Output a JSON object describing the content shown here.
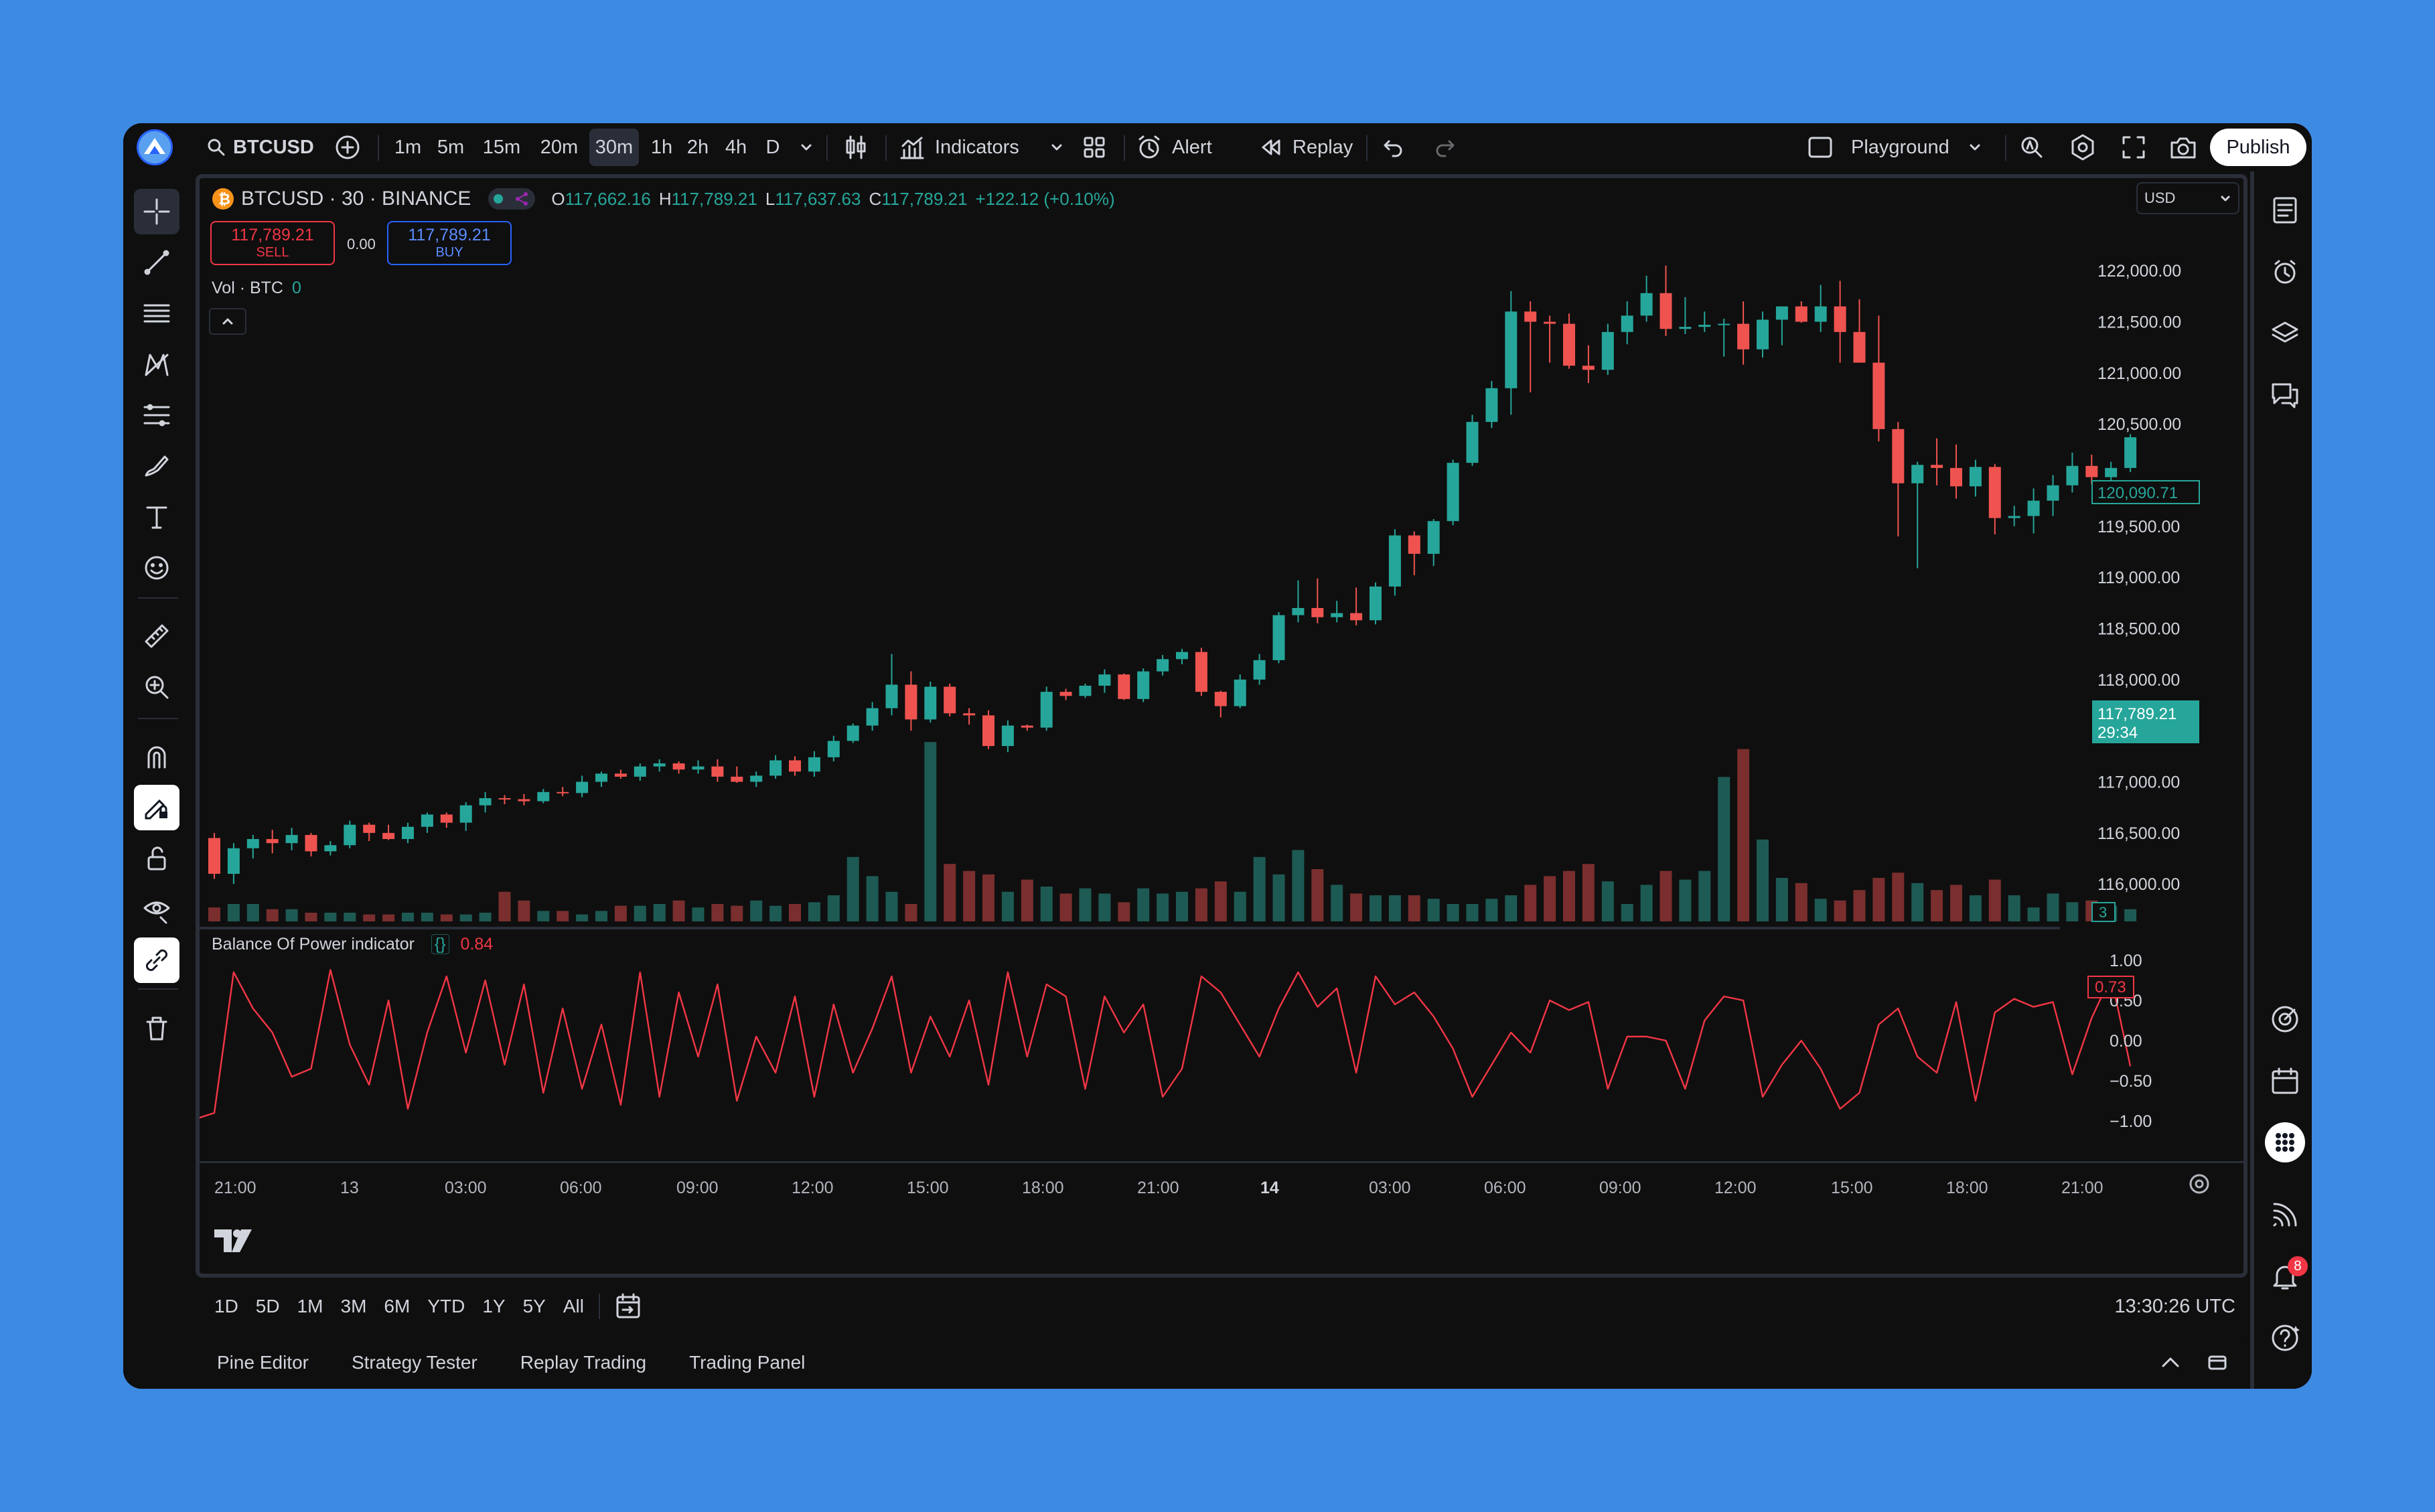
{
  "toolbar": {
    "symbol": "BTCUSD",
    "intervals": [
      "1m",
      "5m",
      "15m",
      "20m",
      "30m",
      "1h",
      "2h",
      "4h",
      "D"
    ],
    "active_interval": "30m",
    "indicators_label": "Indicators",
    "alert_label": "Alert",
    "replay_label": "Replay",
    "layout_name": "Playground",
    "publish_label": "Publish"
  },
  "legend": {
    "title": "BTCUSD · 30 · BINANCE",
    "o_label": "O",
    "o_value": "117,662.16",
    "h_label": "H",
    "h_value": "117,789.21",
    "l_label": "L",
    "l_value": "117,637.63",
    "c_label": "C",
    "c_value": "117,789.21",
    "change": "+122.12 (+0.10%)",
    "sell_price": "117,789.21",
    "sell_label": "SELL",
    "spread": "0.00",
    "buy_price": "117,789.21",
    "buy_label": "BUY",
    "vol_label": "Vol · BTC",
    "vol_value": "0"
  },
  "price_axis": {
    "currency": "USD",
    "labels": [
      "122,000.00",
      "121,500.00",
      "121,000.00",
      "120,500.00",
      "120,000.00",
      "119,500.00",
      "119,000.00",
      "118,500.00",
      "118,000.00",
      "117,500.00",
      "117,000.00",
      "116,500.00",
      "116,000.00"
    ],
    "crosshair_price": "120,090.71",
    "last_price": "117,789.21",
    "countdown": "29:34",
    "volume_badge": "3"
  },
  "indicator": {
    "name": "Balance Of Power indicator",
    "braces": "{}",
    "value": "0.84",
    "axis_labels": [
      "1.00",
      "0.50",
      "0.00",
      "−0.50",
      "−1.00"
    ],
    "last_badge": "0.73"
  },
  "time_axis": [
    "21:00",
    "13",
    "03:00",
    "06:00",
    "09:00",
    "12:00",
    "15:00",
    "18:00",
    "21:00",
    "14",
    "03:00",
    "06:00",
    "09:00",
    "12:00",
    "15:00",
    "18:00",
    "21:00"
  ],
  "ranges": [
    "1D",
    "5D",
    "1M",
    "3M",
    "6M",
    "YTD",
    "1Y",
    "5Y",
    "All"
  ],
  "clock": "13:30:26 UTC",
  "bottom_tabs": [
    "Pine Editor",
    "Strategy Tester",
    "Replay Trading",
    "Trading Panel"
  ],
  "notification_count": "8",
  "colors": {
    "up": "#26a69a",
    "down": "#ef5350",
    "up_vol": "#1e5a54",
    "down_vol": "#7a2e2e",
    "bop": "#f23645",
    "background": "#0f0f0f"
  },
  "chart_data": {
    "type": "candlestick",
    "series": [
      {
        "name": "BTCUSD",
        "candles": [
          [
            116450,
            116500,
            116050,
            116100
          ],
          [
            116100,
            116400,
            116000,
            116350
          ],
          [
            116350,
            116480,
            116250,
            116440
          ],
          [
            116440,
            116530,
            116300,
            116400
          ],
          [
            116400,
            116550,
            116330,
            116480
          ],
          [
            116480,
            116500,
            116270,
            116320
          ],
          [
            116320,
            116420,
            116280,
            116380
          ],
          [
            116380,
            116620,
            116350,
            116580
          ],
          [
            116580,
            116600,
            116420,
            116500
          ],
          [
            116500,
            116580,
            116430,
            116440
          ],
          [
            116440,
            116600,
            116400,
            116560
          ],
          [
            116560,
            116700,
            116500,
            116680
          ],
          [
            116680,
            116700,
            116550,
            116600
          ],
          [
            116600,
            116800,
            116520,
            116770
          ],
          [
            116770,
            116900,
            116700,
            116840
          ],
          [
            116840,
            116870,
            116780,
            116830
          ],
          [
            116830,
            116880,
            116770,
            116810
          ],
          [
            116810,
            116930,
            116790,
            116900
          ],
          [
            116900,
            116950,
            116860,
            116890
          ],
          [
            116890,
            117060,
            116850,
            117000
          ],
          [
            117000,
            117100,
            116950,
            117080
          ],
          [
            117080,
            117120,
            117030,
            117050
          ],
          [
            117050,
            117180,
            117010,
            117150
          ],
          [
            117150,
            117220,
            117100,
            117180
          ],
          [
            117180,
            117200,
            117080,
            117120
          ],
          [
            117120,
            117210,
            117080,
            117150
          ],
          [
            117150,
            117220,
            117000,
            117050
          ],
          [
            117050,
            117150,
            116990,
            117000
          ],
          [
            117000,
            117100,
            116950,
            117060
          ],
          [
            117060,
            117260,
            117030,
            117210
          ],
          [
            117210,
            117250,
            117060,
            117100
          ],
          [
            117100,
            117300,
            117050,
            117240
          ],
          [
            117240,
            117450,
            117200,
            117400
          ],
          [
            117400,
            117570,
            117380,
            117550
          ],
          [
            117550,
            117780,
            117500,
            117720
          ],
          [
            117720,
            118250,
            117650,
            117950
          ],
          [
            117950,
            118080,
            117500,
            117610
          ],
          [
            117610,
            117980,
            117580,
            117930
          ],
          [
            117930,
            117960,
            117640,
            117670
          ],
          [
            117670,
            117720,
            117560,
            117650
          ],
          [
            117650,
            117700,
            117320,
            117350
          ],
          [
            117350,
            117600,
            117290,
            117550
          ],
          [
            117550,
            117560,
            117500,
            117530
          ],
          [
            117530,
            117930,
            117500,
            117880
          ],
          [
            117880,
            117910,
            117800,
            117840
          ],
          [
            117840,
            117960,
            117820,
            117940
          ],
          [
            117940,
            118100,
            117870,
            118050
          ],
          [
            118050,
            118060,
            117800,
            117810
          ],
          [
            117810,
            118110,
            117780,
            118080
          ],
          [
            118080,
            118240,
            118040,
            118200
          ],
          [
            118200,
            118300,
            118150,
            118270
          ],
          [
            118270,
            118310,
            117840,
            117880
          ],
          [
            117880,
            117890,
            117630,
            117740
          ],
          [
            117740,
            118050,
            117720,
            118000
          ],
          [
            118000,
            118250,
            117950,
            118190
          ],
          [
            118190,
            118660,
            118160,
            118630
          ],
          [
            118630,
            118970,
            118560,
            118700
          ],
          [
            118700,
            118990,
            118550,
            118610
          ],
          [
            118610,
            118770,
            118560,
            118650
          ],
          [
            118650,
            118900,
            118530,
            118580
          ],
          [
            118580,
            118950,
            118540,
            118910
          ],
          [
            118910,
            119470,
            118820,
            119410
          ],
          [
            119410,
            119450,
            119020,
            119230
          ],
          [
            119230,
            119570,
            119110,
            119550
          ],
          [
            119550,
            120150,
            119510,
            120120
          ],
          [
            120120,
            120590,
            120090,
            120520
          ],
          [
            120520,
            120920,
            120460,
            120850
          ],
          [
            120850,
            121800,
            120590,
            121600
          ],
          [
            121600,
            121700,
            120810,
            121500
          ],
          [
            121500,
            121560,
            121100,
            121480
          ],
          [
            121480,
            121580,
            121040,
            121070
          ],
          [
            121070,
            121270,
            120900,
            121030
          ],
          [
            121030,
            121480,
            120980,
            121400
          ],
          [
            121400,
            121700,
            121280,
            121560
          ],
          [
            121560,
            121950,
            121500,
            121780
          ],
          [
            121780,
            122050,
            121360,
            121430
          ],
          [
            121430,
            121740,
            121380,
            121450
          ],
          [
            121450,
            121600,
            121400,
            121470
          ],
          [
            121470,
            121530,
            121160,
            121480
          ],
          [
            121480,
            121700,
            121080,
            121230
          ],
          [
            121230,
            121600,
            121150,
            121520
          ],
          [
            121520,
            121650,
            121270,
            121650
          ],
          [
            121650,
            121700,
            121490,
            121500
          ],
          [
            121500,
            121860,
            121400,
            121650
          ],
          [
            121650,
            121900,
            121100,
            121400
          ],
          [
            121400,
            121720,
            121120,
            121100
          ],
          [
            121100,
            121560,
            120330,
            120450
          ],
          [
            120450,
            120520,
            119400,
            119920
          ],
          [
            119920,
            120130,
            119090,
            120100
          ],
          [
            120100,
            120360,
            119900,
            120070
          ],
          [
            120070,
            120300,
            119770,
            119890
          ],
          [
            119890,
            120150,
            119790,
            120080
          ],
          [
            120080,
            120110,
            119420,
            119580
          ],
          [
            119580,
            119700,
            119500,
            119600
          ],
          [
            119600,
            119870,
            119430,
            119750
          ],
          [
            119750,
            120000,
            119600,
            119900
          ],
          [
            119900,
            120220,
            119830,
            120090
          ],
          [
            120090,
            120200,
            119910,
            119980
          ],
          [
            119980,
            120130,
            119850,
            120070
          ],
          [
            120070,
            120400,
            120030,
            120370
          ]
        ]
      },
      {
        "name": "Vol · BTC",
        "values": [
          0.8,
          1,
          1,
          0.7,
          0.7,
          0.5,
          0.5,
          0.5,
          0.4,
          0.4,
          0.5,
          0.5,
          0.4,
          0.4,
          0.5,
          1.7,
          1.2,
          0.6,
          0.6,
          0.4,
          0.6,
          0.9,
          0.9,
          1,
          1.2,
          0.8,
          1,
          0.9,
          1.2,
          0.9,
          1,
          1.1,
          1.5,
          3.7,
          2.6,
          1.7,
          1,
          10.3,
          3.3,
          2.9,
          2.7,
          1.7,
          2.4,
          2,
          1.6,
          1.9,
          1.6,
          1.1,
          1.9,
          1.6,
          1.7,
          1.9,
          2.3,
          1.7,
          3.7,
          2.7,
          4.1,
          3,
          2.1,
          1.6,
          1.5,
          1.5,
          1.5,
          1.3,
          1,
          1,
          1.3,
          1.5,
          2.1,
          2.6,
          2.9,
          3.3,
          2.3,
          1,
          2.1,
          2.9,
          2.4,
          2.9,
          8.3,
          9.9,
          4.7,
          2.5,
          2.2,
          1.3,
          1.2,
          1.8,
          2.5,
          2.8,
          2.2,
          1.8,
          2.1,
          1.5,
          2.4,
          1.5,
          0.8,
          1.6,
          1.1,
          1.2,
          0.9,
          0.7,
          0.5,
          0.4,
          0.6
        ]
      },
      {
        "name": "Balance Of Power indicator",
        "values": [
          -0.9,
          0.85,
          0.4,
          0.1,
          -0.45,
          -0.35,
          0.88,
          -0.05,
          -0.55,
          0.5,
          -0.85,
          0.1,
          0.8,
          -0.15,
          0.75,
          -0.3,
          0.7,
          -0.65,
          0.4,
          -0.6,
          0.2,
          -0.8,
          0.85,
          -0.7,
          0.6,
          -0.2,
          0.7,
          -0.75,
          0.05,
          -0.4,
          0.55,
          -0.7,
          0.45,
          -0.4,
          0.15,
          0.8,
          -0.4,
          0.3,
          -0.2,
          0.5,
          -0.55,
          0.85,
          -0.2,
          0.7,
          0.55,
          -0.6,
          0.55,
          0.1,
          0.45,
          -0.7,
          -0.35,
          0.8,
          0.6,
          0.2,
          -0.2,
          0.4,
          0.85,
          0.42,
          0.65,
          -0.4,
          0.8,
          0.45,
          0.6,
          0.3,
          -0.1,
          -0.7,
          -0.3,
          0.1,
          -0.15,
          0.5,
          0.38,
          0.48,
          -0.6,
          0.05,
          0.05,
          0.0,
          -0.6,
          0.25,
          0.55,
          0.5,
          -0.7,
          -0.3,
          0.0,
          -0.35,
          -0.85,
          -0.65,
          0.2,
          0.4,
          -0.2,
          -0.4,
          0.48,
          -0.75,
          0.35,
          0.52,
          0.42,
          0.48,
          -0.42,
          0.28,
          0.8,
          -0.32
        ]
      }
    ],
    "ylim": [
      115700,
      122250
    ],
    "bop_ylim": [
      -1,
      1
    ]
  }
}
